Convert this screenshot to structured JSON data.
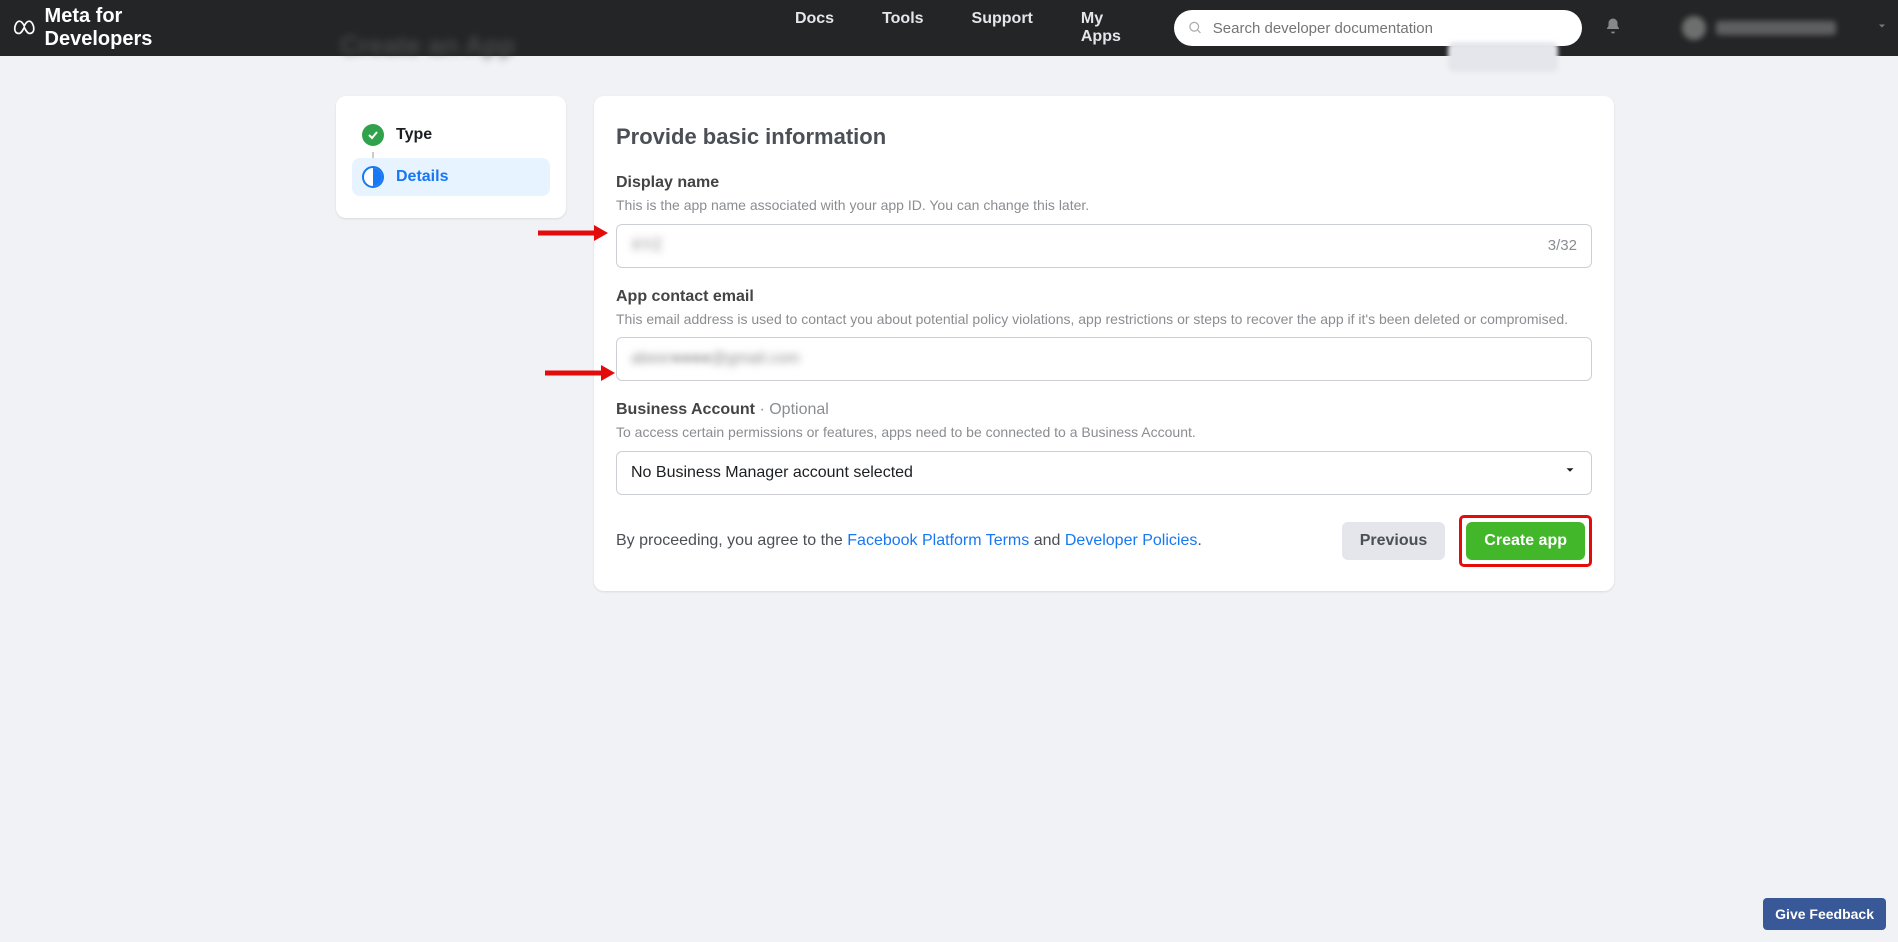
{
  "brand": {
    "title": "Meta for Developers"
  },
  "nav": {
    "docs": "Docs",
    "tools": "Tools",
    "support": "Support",
    "myapps": "My Apps"
  },
  "search": {
    "placeholder": "Search developer documentation"
  },
  "ghost": {
    "title": "Create an App"
  },
  "sidebar": {
    "step1_label": "Type",
    "step2_label": "Details"
  },
  "card": {
    "title": "Provide basic information",
    "display_name": {
      "label": "Display name",
      "hint": "This is the app name associated with your app ID. You can change this later.",
      "value": "XYZ",
      "count": "3/32"
    },
    "email": {
      "label": "App contact email",
      "hint": "This email address is used to contact you about potential policy violations, app restrictions or steps to recover the app if it's been deleted or compromised.",
      "value": "abeer●●●●@gmail.com"
    },
    "business": {
      "label": "Business Account",
      "optional": " · Optional",
      "hint": "To access certain permissions or features, apps need to be connected to a Business Account.",
      "selected": "No Business Manager account selected"
    },
    "agree": {
      "prefix": "By proceeding, you agree to the ",
      "link1": "Facebook Platform Terms",
      "middle": " and ",
      "link2": "Developer Policies",
      "suffix": "."
    },
    "btn_prev": "Previous",
    "btn_create": "Create app"
  },
  "feedback": "Give Feedback"
}
